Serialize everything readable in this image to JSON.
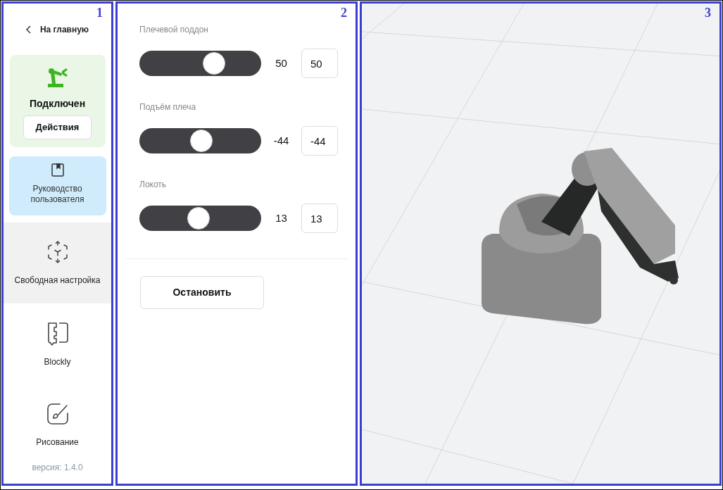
{
  "panel_numbers": [
    "1",
    "2",
    "3"
  ],
  "sidebar": {
    "back_link": "На главную",
    "status": {
      "label": "Подключен",
      "connected": true,
      "button": "Действия"
    },
    "guide": "Руководство пользователя",
    "items": [
      {
        "kind": "free",
        "label": "Свободная настройка",
        "selected": true
      },
      {
        "kind": "blockly",
        "label": "Blockly",
        "selected": false
      },
      {
        "kind": "draw",
        "label": "Рисование",
        "selected": false
      }
    ],
    "version": "версия: 1.4.0"
  },
  "joints": [
    {
      "label": "Плечевой поддон",
      "level": 0.645,
      "reading": "50",
      "value": "50"
    },
    {
      "label": "Подъём плеча",
      "level": 0.51,
      "reading": "-44",
      "value": "-44"
    },
    {
      "label": "Локоть",
      "level": 0.48,
      "reading": "13",
      "value": "13"
    }
  ],
  "stop_button": "Остановить"
}
